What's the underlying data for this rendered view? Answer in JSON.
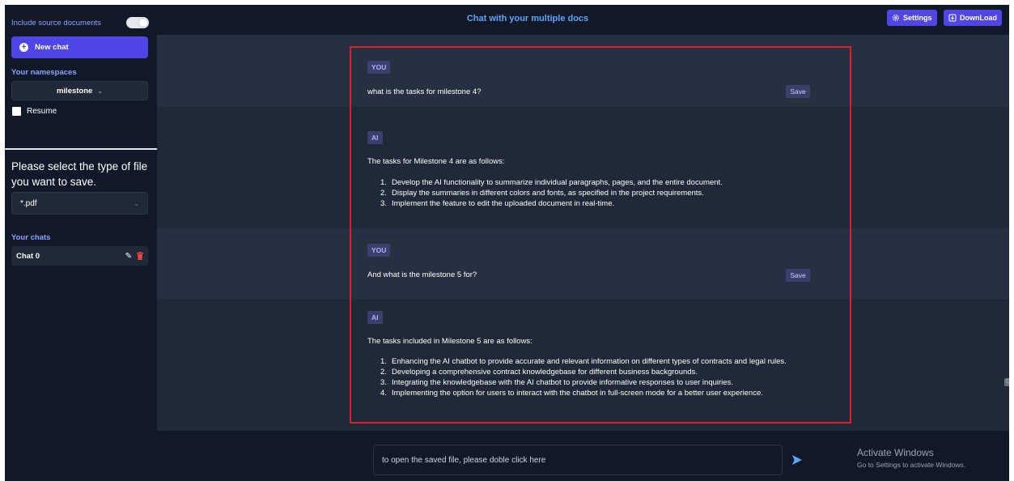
{
  "sidebar": {
    "toggle_label": "Include source documents",
    "new_chat_label": "New chat",
    "namespaces_title": "Your namespaces",
    "namespace_selected": "milestone",
    "resume_label": "Resume",
    "file_type_title": "Please select the type of file you want to save.",
    "file_type_selected": "*.pdf",
    "chats_title": "Your chats",
    "chats": [
      {
        "label": "Chat 0"
      }
    ]
  },
  "header": {
    "title": "Chat with your multiple docs",
    "settings_label": "Settings",
    "download_label": "DownLoad"
  },
  "messages": [
    {
      "role": "YOU",
      "text": "what is the tasks for milestone 4?",
      "save_label": "Save"
    },
    {
      "role": "AI",
      "intro": "The tasks for Milestone 4 are as follows:",
      "items": [
        "Develop the AI functionality to summarize individual paragraphs, pages, and the entire document.",
        "Display the summaries in different colors and fonts, as specified in the project requirements.",
        "Implement the feature to edit the uploaded document in real-time."
      ]
    },
    {
      "role": "YOU",
      "text": "And what is the milestone 5 for?",
      "save_label": "Save"
    },
    {
      "role": "AI",
      "intro": "The tasks included in Milestone 5 are as follows:",
      "items": [
        "Enhancing the AI chatbot to provide accurate and relevant information on different types of contracts and legal rules.",
        "Developing a comprehensive contract knowledgebase for different business backgrounds.",
        "Integrating the knowledgebase with the AI chatbot to provide informative responses to user inquiries.",
        "Implementing the option for users to interact with the chatbot in full-screen mode for a better user experience."
      ]
    }
  ],
  "input": {
    "placeholder": "to open the saved file, please doble click here"
  },
  "watermark": {
    "line1": "Activate Windows",
    "line2": "Go to Settings to activate Windows."
  },
  "colors": {
    "accent": "#4f46e5",
    "title_blue": "#60a5fa",
    "highlight_red": "#e11d2a",
    "sidebar_bg": "#111827"
  },
  "icons": {
    "new_chat": "plus-circle-icon",
    "settings": "gear-icon",
    "download": "download-icon",
    "edit": "pencil-icon",
    "delete": "trash-icon",
    "send": "send-arrow-icon"
  }
}
